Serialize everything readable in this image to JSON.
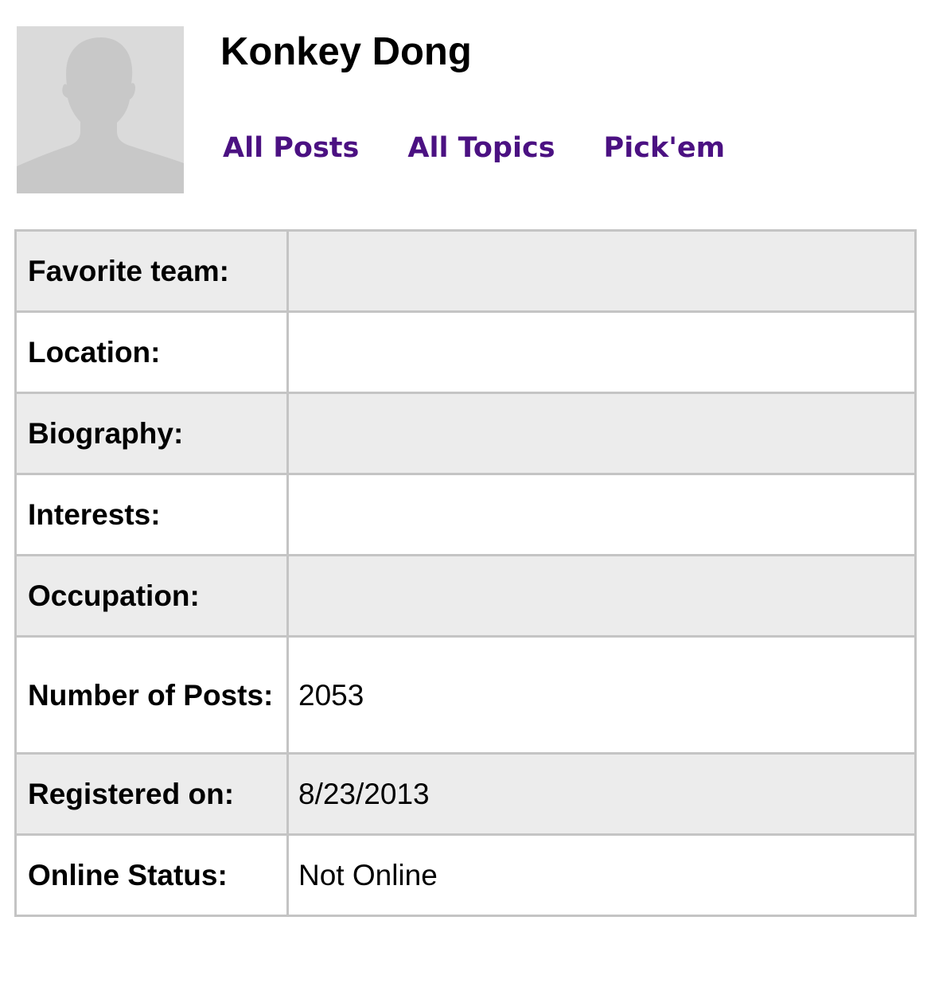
{
  "profile": {
    "display_name": "Konkey Dong",
    "avatar_icon": "default-user-silhouette-icon"
  },
  "nav": {
    "all_posts": "All Posts",
    "all_topics": "All Topics",
    "pickem": "Pick'em",
    "link_color": "#4b1182"
  },
  "details": {
    "favorite_team": {
      "label": "Favorite team:",
      "value": ""
    },
    "location": {
      "label": "Location:",
      "value": ""
    },
    "biography": {
      "label": "Biography:",
      "value": ""
    },
    "interests": {
      "label": "Interests:",
      "value": ""
    },
    "occupation": {
      "label": "Occupation:",
      "value": ""
    },
    "number_of_posts": {
      "label": "Number of Posts:",
      "value": "2053"
    },
    "registered_on": {
      "label": "Registered on:",
      "value": "8/23/2013"
    },
    "online_status": {
      "label": "Online Status:",
      "value": "Not Online"
    }
  },
  "colors": {
    "row_shade": "#ececec",
    "border": "#c4c4c4",
    "avatar_bg": "#dadada",
    "avatar_silhouette": "#c8c8c8"
  }
}
